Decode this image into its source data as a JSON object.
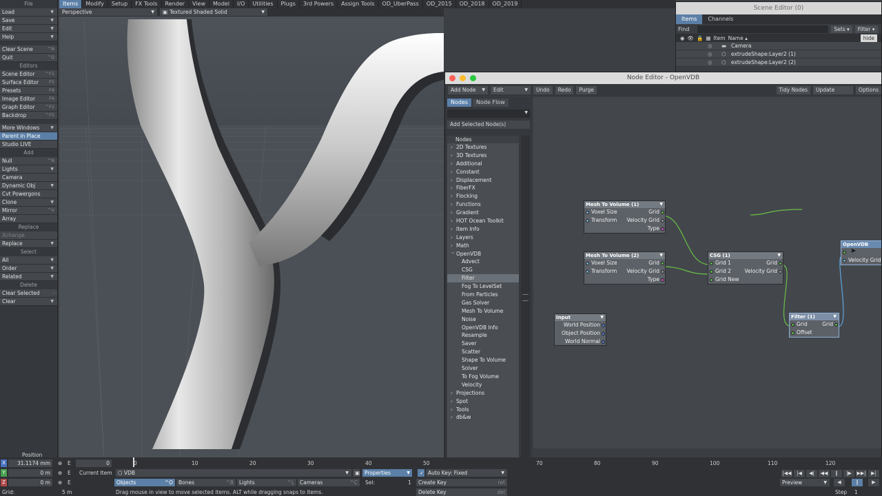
{
  "top_tabs": [
    "Items",
    "Modify",
    "Setup",
    "FX Tools",
    "Render",
    "View",
    "Model",
    "I/O",
    "Utilities",
    "Plugs",
    "3rd Powers",
    "Assign Tools",
    "OD_UberPass",
    "OD_2015",
    "OD_2018",
    "OD_2019"
  ],
  "left_toolbar": {
    "file": {
      "header": "File",
      "items": [
        {
          "label": "Load",
          "dd": true
        },
        {
          "label": "Save",
          "dd": true
        },
        {
          "label": "Edit",
          "dd": true
        },
        {
          "label": "Help",
          "dd": true
        }
      ]
    },
    "file2": [
      {
        "label": "Clear Scene",
        "sc": "^N"
      },
      {
        "label": "Quit",
        "sc": "^Q"
      }
    ],
    "editors": {
      "header": "Editors",
      "items": [
        {
          "label": "Scene Editor",
          "sc": "^F1"
        },
        {
          "label": "Surface Editor",
          "sc": "F5"
        },
        {
          "label": "Presets",
          "sc": "F8"
        },
        {
          "label": "Image Editor",
          "sc": "F6"
        },
        {
          "label": "Graph Editor",
          "sc": "^F2"
        },
        {
          "label": "Backdrop",
          "sc": "^F5"
        }
      ]
    },
    "editors2": [
      {
        "label": "More Windows",
        "dd": true
      },
      {
        "label": "Parent in Place",
        "blue": true
      },
      {
        "label": "Studio LIVE"
      }
    ],
    "add": {
      "header": "Add",
      "items": [
        {
          "label": "Null",
          "sc": "^N"
        },
        {
          "label": "Lights",
          "dd": true
        },
        {
          "label": "Camera"
        },
        {
          "label": "Dynamic Obj",
          "dd": true
        },
        {
          "label": "Cvt Powergons"
        },
        {
          "label": "Clone",
          "dd": true
        },
        {
          "label": "Mirror",
          "sc": "^V"
        },
        {
          "label": "Array"
        }
      ]
    },
    "replace": {
      "header": "Replace",
      "items": [
        {
          "label": "Xchange",
          "dim": true
        },
        {
          "label": "Replace",
          "dd": true
        }
      ]
    },
    "select": {
      "header": "Select",
      "items": [
        {
          "label": "All",
          "dd": true
        },
        {
          "label": "Order",
          "dd": true
        },
        {
          "label": "Related",
          "dd": true
        }
      ]
    },
    "delete": {
      "header": "Delete",
      "items": [
        {
          "label": "Clear Selected",
          "sc": "-"
        },
        {
          "label": "Clear",
          "dd": true
        }
      ]
    }
  },
  "viewport": {
    "view": "Perspective",
    "shading": "Textured Shaded Solid"
  },
  "scene_editor": {
    "title": "Scene Editor (0)",
    "tabs": [
      "Items",
      "Channels"
    ],
    "find": "Find",
    "sets": "Sets",
    "filter": "Filter",
    "hide": "hide",
    "columns": {
      "item": "Item",
      "name": "Name ▴"
    },
    "rows": [
      "Camera",
      "extrudeShape:Layer2 (1)",
      "extrudeShape:Layer2 (2)"
    ]
  },
  "node_editor": {
    "title": "Node Editor - OpenVDB",
    "toolbar": {
      "add_node": "Add Node",
      "edit": "Edit",
      "undo": "Undo",
      "redo": "Redo",
      "purge": "Purge",
      "tidy": "Tidy Nodes",
      "update": "Update",
      "options": "Options"
    },
    "tabs": [
      "Nodes",
      "Node Flow"
    ],
    "add_selected": "Add Selected Node(s)",
    "list_header": "Nodes",
    "categories_a": [
      "2D Textures",
      "3D Textures",
      "Additional",
      "Constant",
      "Displacement",
      "FiberFX",
      "Flocking",
      "Functions",
      "Gradient",
      "HOT Ocean Toolkit",
      "Item Info",
      "Layers",
      "Math"
    ],
    "open_category": "OpenVDB",
    "openvdb_items": [
      "Advect",
      "CSG",
      "Filter",
      "Fog To LevelSet",
      "From Particles",
      "Gas Solver",
      "Mesh To Volume",
      "Noise",
      "OpenVDB Info",
      "Resample",
      "Saver",
      "Scatter",
      "Shape To Volume",
      "Solver",
      "To Fog Volume",
      "Velocity"
    ],
    "selected_item": "Filter",
    "categories_b": [
      "Projections",
      "Spot",
      "Tools",
      "db&w"
    ],
    "nodes": {
      "mtv1": {
        "title": "Mesh To Volume (1)",
        "in1": "Voxel Size",
        "in2": "Transform",
        "out1": "Grid",
        "out2": "Velocity Grid",
        "out3": "Type"
      },
      "mtv2": {
        "title": "Mesh To Volume (2)",
        "in1": "Voxel Size",
        "in2": "Transform",
        "out1": "Grid",
        "out2": "Velocity Grid",
        "out3": "Type"
      },
      "csg": {
        "title": "CSG (1)",
        "in1": "Grid 1",
        "in2": "Grid 2",
        "in3": "Grid New",
        "out1": "Grid",
        "out2": "Velocity Grid"
      },
      "input": {
        "title": "Input",
        "out1": "World Position",
        "out2": "Object Position",
        "out3": "World Normal"
      },
      "filter": {
        "title": "Filter (1)",
        "in1": "Grid",
        "in2": "Offset",
        "out1": "Grid"
      },
      "openvdb": {
        "title": "OpenVDB",
        "in1": "Velocity Grid"
      }
    }
  },
  "bottom": {
    "position_label": "Position",
    "x": "31.1174 mm",
    "y": "0 m",
    "z": "0 m",
    "grid_label": "Grid:",
    "grid": "5 m",
    "current_item_label": "Current Item",
    "current_item": "VDB",
    "properties": "Properties",
    "sel_label": "Sel:",
    "sel": "1",
    "autokey": "Auto Key: Fixed",
    "create_key": "Create Key",
    "create_key_sc": "ret",
    "delete_key": "Delete Key",
    "delete_key_sc": "del",
    "objects": "Objects",
    "objects_sc": "^O",
    "bones": "Bones",
    "bones_sc": "^B",
    "lights": "Lights",
    "lights_sc": "^L",
    "cameras": "Cameras",
    "cameras_sc": "^C",
    "status": "Drag mouse in view to move selected items. ALT while dragging snaps to items.",
    "timeline_ticks": [
      "0",
      "10",
      "20",
      "30",
      "40",
      "50",
      "70",
      "80",
      "90",
      "100",
      "110",
      "120"
    ],
    "frame_field": "0",
    "preview": "Preview",
    "step_label": "Step",
    "step": "1"
  }
}
